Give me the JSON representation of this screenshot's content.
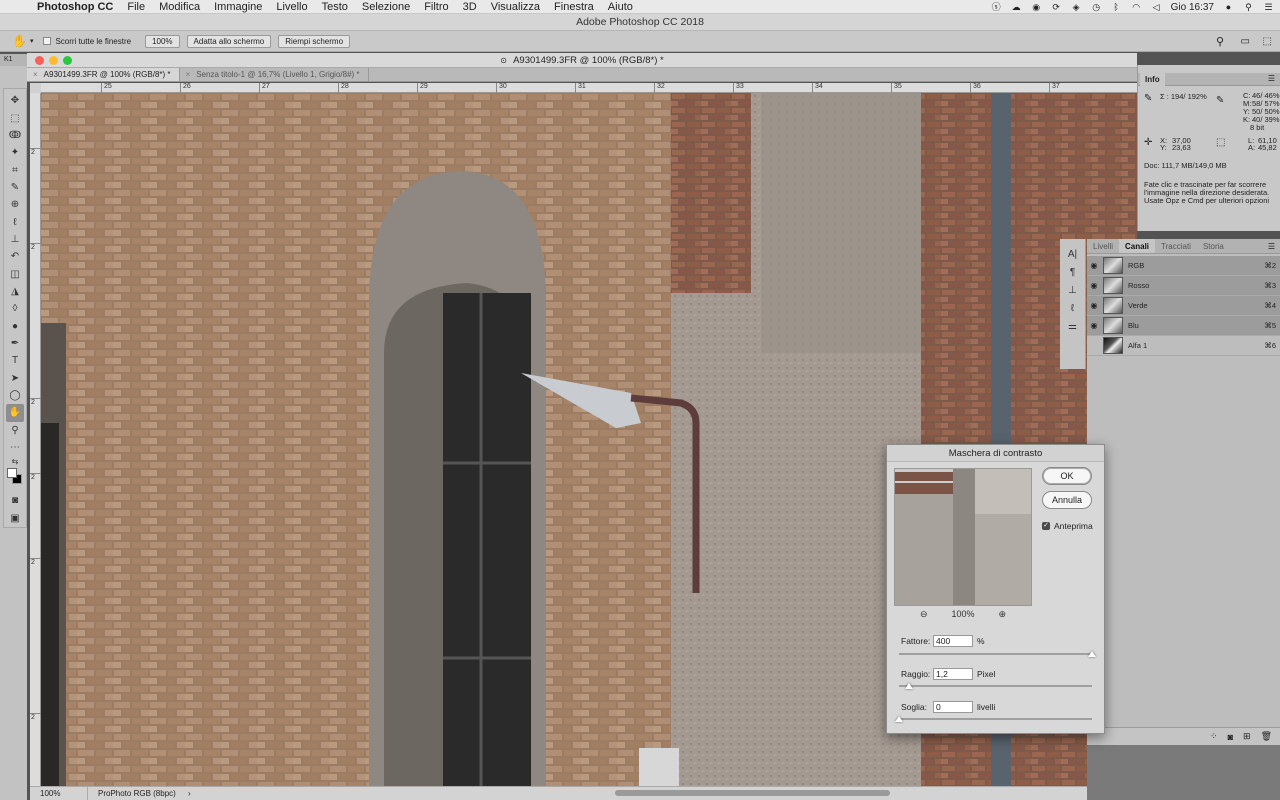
{
  "menubar": {
    "app": "Photoshop CC",
    "items": [
      "File",
      "Modifica",
      "Immagine",
      "Livello",
      "Testo",
      "Selezione",
      "Filtro",
      "3D",
      "Visualizza",
      "Finestra",
      "Aiuto"
    ],
    "clock": "Gio 16:37"
  },
  "app_title": "Adobe Photoshop CC 2018",
  "options": {
    "scroll_all": "Scorri tutte le finestre",
    "zoom100": "100%",
    "fit_screen": "Adatta allo schermo",
    "fill_screen": "Riempi schermo"
  },
  "document": {
    "title": "A9301499.3FR @ 100% (RGB/8*) *",
    "left_tab": "K1",
    "tabs": [
      {
        "label": "A9301499.3FR @ 100% (RGB/8*) *",
        "active": true
      },
      {
        "label": "Senza titolo-1 @ 16,7% (Livello 1, Grigio/8#) *",
        "active": false
      }
    ]
  },
  "rulers": {
    "h": [
      "25",
      "26",
      "27",
      "28",
      "29",
      "30",
      "31",
      "32",
      "33",
      "34",
      "35",
      "36",
      "37"
    ],
    "v": [
      "2",
      "2",
      "2",
      "2",
      "2",
      "2"
    ]
  },
  "status": {
    "zoom": "100%",
    "profile": "ProPhoto RGB (8bpc)"
  },
  "info": {
    "tab": "Info",
    "sigma": "Σ : 194/  192%",
    "cmyk": [
      {
        "k": "C:",
        "v": "46/  46%"
      },
      {
        "k": "M:",
        "v": "58/  57%"
      },
      {
        "k": "Y:",
        "v": "50/  50%"
      },
      {
        "k": "K:",
        "v": "40/  39%"
      }
    ],
    "bits": "8 bit",
    "x": "37,00",
    "y": "23,63",
    "l": "61,10",
    "a": "45,82",
    "doc": "Doc: 111,7 MB/149,0 MB",
    "hint": [
      "Fate clic e trascinate per far scorrere",
      "l'immagine nella direzione desiderata.",
      "Usate Opz e Cmd per ulteriori opzioni"
    ]
  },
  "channels": {
    "tabs": [
      "Livelli",
      "Canali",
      "Tracciati",
      "Storia"
    ],
    "rows": [
      {
        "name": "RGB",
        "key": "⌘2",
        "visible": true,
        "selected": true
      },
      {
        "name": "Rosso",
        "key": "⌘3",
        "visible": true,
        "selected": true
      },
      {
        "name": "Verde",
        "key": "⌘4",
        "visible": true,
        "selected": true
      },
      {
        "name": "Blu",
        "key": "⌘5",
        "visible": true,
        "selected": true
      },
      {
        "name": "Alfa 1",
        "key": "⌘6",
        "visible": false,
        "selected": false
      }
    ]
  },
  "dialog": {
    "title": "Maschera di contrasto",
    "ok": "OK",
    "cancel": "Annulla",
    "preview_label": "Anteprima",
    "preview_zoom": "100%",
    "amount_label": "Fattore:",
    "amount_value": "400",
    "amount_unit": "%",
    "amount_level": 1.0,
    "radius_label": "Raggio:",
    "radius_value": "1,2",
    "radius_unit": "Pixel",
    "radius_level": 0.05,
    "threshold_label": "Soglia:",
    "threshold_value": "0",
    "threshold_unit": "livelli",
    "threshold_level": 0.0
  }
}
